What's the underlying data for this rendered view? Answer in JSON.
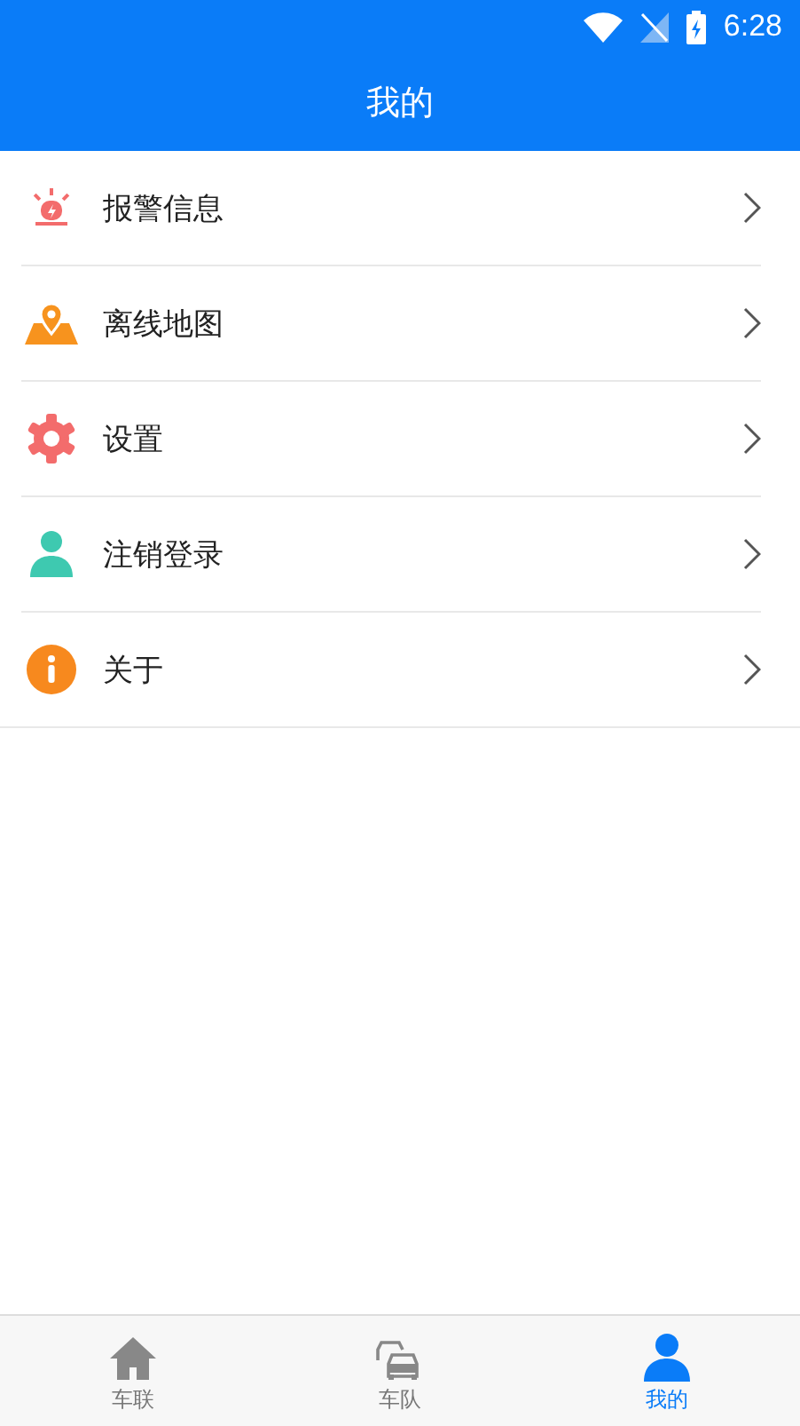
{
  "status_bar": {
    "time": "6:28"
  },
  "header": {
    "title": "我的"
  },
  "menu": [
    {
      "kind": "alarm",
      "label": "报警信息"
    },
    {
      "kind": "map",
      "label": "离线地图"
    },
    {
      "kind": "settings",
      "label": "设置"
    },
    {
      "kind": "user",
      "label": "注销登录"
    },
    {
      "kind": "info",
      "label": "关于"
    }
  ],
  "tabs": [
    {
      "kind": "home",
      "label": "车联",
      "selected": false
    },
    {
      "kind": "cars",
      "label": "车队",
      "selected": false
    },
    {
      "kind": "user",
      "label": "我的",
      "selected": true
    }
  ]
}
